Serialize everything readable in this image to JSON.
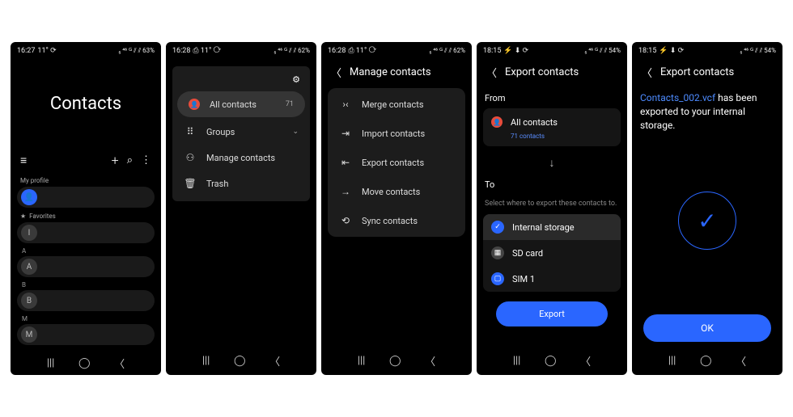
{
  "screens": [
    {
      "status": {
        "time": "16:27",
        "left": "11° ⟳",
        "right": "₅ ⁴⁶ ᴳ ⫽ ⫽ 63%"
      },
      "title": "Contacts",
      "sections": {
        "my_profile": "My profile",
        "favorites": "Favorites"
      },
      "letters": [
        "A",
        "B",
        "M"
      ]
    },
    {
      "status": {
        "time": "16:28",
        "left": "⎙ 11° ⟳",
        "right": "₅ ⁴⁶ ᴳ ⫽ ⫽ 62%"
      },
      "menu": {
        "all_contacts": "All contacts",
        "all_count": "71",
        "groups": "Groups",
        "manage": "Manage contacts",
        "trash": "Trash"
      }
    },
    {
      "status": {
        "time": "16:28",
        "left": "⎙ 11° ⟳",
        "right": "₅ ⁴⁶ ᴳ ⫽ ⫽ 62%"
      },
      "title": "Manage contacts",
      "items": {
        "merge": "Merge contacts",
        "import": "Import contacts",
        "export": "Export contacts",
        "move": "Move contacts",
        "sync": "Sync contacts"
      }
    },
    {
      "status": {
        "time": "18:15",
        "left": "⚡ ⬇ ⟳",
        "right": "₅ ⁴⁶ ᴳ ⫽ ⫽ 54%"
      },
      "title": "Export contacts",
      "from_label": "From",
      "from_name": "All contacts",
      "from_count": "71 contacts",
      "to_label": "To",
      "help": "Select where to export these contacts to.",
      "dest": {
        "internal": "Internal storage",
        "sd": "SD card",
        "sim": "SIM 1"
      },
      "export_btn": "Export"
    },
    {
      "status": {
        "time": "18:15",
        "left": "⚡ ⬇ ⟳",
        "right": "₅ ⁴⁶ ᴳ ⫽ ⫽ 54%"
      },
      "title": "Export contacts",
      "filename": "Contacts_002.vcf",
      "msg_tail": " has been exported to your internal storage.",
      "ok": "OK"
    }
  ]
}
